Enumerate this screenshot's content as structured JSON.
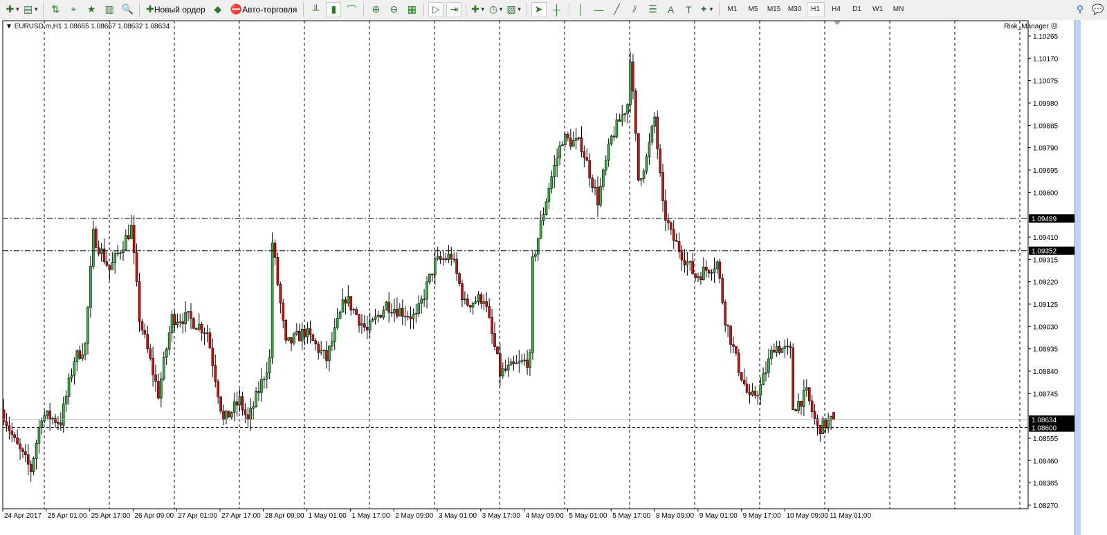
{
  "toolbar": {
    "items": [
      {
        "name": "new-chart-button",
        "glyph": "✚",
        "dd": true
      },
      {
        "name": "profiles-button",
        "glyph": "▤",
        "dd": true
      },
      {
        "sep": true
      },
      {
        "name": "market-watch-button",
        "glyph": "⇅"
      },
      {
        "name": "navigator-button",
        "glyph": "⌖"
      },
      {
        "name": "favorites-button",
        "glyph": "★"
      },
      {
        "name": "terminal-button",
        "glyph": "▥"
      },
      {
        "name": "strategy-tester-button",
        "glyph": "🔍"
      },
      {
        "sep": true
      },
      {
        "name": "new-order-button",
        "glyph": "✚",
        "label": "Новый ордер"
      },
      {
        "name": "metaeditor-button",
        "glyph": "◆"
      },
      {
        "name": "auto-trading-button",
        "glyph": "⛔",
        "label": "Авто-торговля"
      },
      {
        "sep": true
      },
      {
        "name": "bar-chart-button",
        "glyph": "╨"
      },
      {
        "name": "candlestick-button",
        "glyph": "▮",
        "active": true
      },
      {
        "name": "line-chart-button",
        "glyph": "⌒"
      },
      {
        "sep": true
      },
      {
        "name": "zoom-in-button",
        "glyph": "⊕"
      },
      {
        "name": "zoom-out-button",
        "glyph": "⊖"
      },
      {
        "name": "tile-windows-button",
        "glyph": "▦"
      },
      {
        "sep": true
      },
      {
        "name": "autoscroll-button",
        "glyph": "▷",
        "active": true
      },
      {
        "name": "chart-shift-button",
        "glyph": "⇥",
        "active": true
      },
      {
        "sep": true
      },
      {
        "name": "indicators-button",
        "glyph": "✚",
        "dd": true
      },
      {
        "name": "periods-button",
        "glyph": "◷",
        "dd": true
      },
      {
        "name": "templates-button",
        "glyph": "▨",
        "dd": true
      },
      {
        "sep": true
      },
      {
        "name": "cursor-button",
        "glyph": "➤",
        "active": true
      },
      {
        "name": "crosshair-button",
        "glyph": "┼"
      },
      {
        "sep": true
      },
      {
        "name": "vertical-line-button",
        "glyph": "│"
      },
      {
        "name": "horizontal-line-button",
        "glyph": "—"
      },
      {
        "name": "trendline-button",
        "glyph": "╱"
      },
      {
        "name": "equidistant-channel-button",
        "glyph": "⫽"
      },
      {
        "name": "fibonacci-button",
        "glyph": "☰"
      },
      {
        "name": "text-button",
        "glyph": "A"
      },
      {
        "name": "text-label-button",
        "glyph": "T"
      },
      {
        "name": "arrows-button",
        "glyph": "✦",
        "dd": true
      },
      {
        "sep": true
      }
    ],
    "timeframes": [
      "M1",
      "M5",
      "M15",
      "M30",
      "H1",
      "H4",
      "D1",
      "W1",
      "MN"
    ],
    "active_timeframe": "H1"
  },
  "chart": {
    "header": "EURUSD.m,H1  1.08665 1.08667 1.08632 1.08634",
    "indicator_label": "Risk_Manager",
    "price_ticks": [
      "1.10265",
      "1.10170",
      "1.10075",
      "1.09980",
      "1.09885",
      "1.09790",
      "1.09695",
      "1.09600",
      "1.09410",
      "1.09315",
      "1.09220",
      "1.09125",
      "1.09030",
      "1.08935",
      "1.08840",
      "1.08745",
      "1.08555",
      "1.08460",
      "1.08365",
      "1.08270"
    ],
    "time_labels": [
      "24 Apr 2017",
      "25 Apr 01:00",
      "25 Apr 17:00",
      "26 Apr 09:00",
      "27 Apr 01:00",
      "27 Apr 17:00",
      "28 Apr 09:00",
      "1 May 01:00",
      "1 May 17:00",
      "2 May 09:00",
      "3 May 01:00",
      "3 May 17:00",
      "4 May 09:00",
      "5 May 01:00",
      "5 May 17:00",
      "8 May 09:00",
      "9 May 01:00",
      "9 May 17:00",
      "10 May 09:00",
      "11 May 01:00"
    ],
    "hlines": [
      {
        "price": 1.09489,
        "label": "1.09489",
        "style": "dashdot"
      },
      {
        "price": 1.09352,
        "label": "1.09352",
        "style": "dashdot"
      },
      {
        "price": 1.086,
        "label": "1.08600",
        "style": "dashed"
      },
      {
        "price": 1.08634,
        "label": "1.08634",
        "style": "bid"
      }
    ],
    "colors": {
      "bull": "#3cb043",
      "bear": "#d01010",
      "wick": "#000000",
      "grid": "#000000",
      "bid": "#b0b0b0"
    }
  },
  "chart_data": {
    "type": "candlestick",
    "symbol": "EURUSD.m",
    "timeframe": "H1",
    "ylim": [
      1.0827,
      1.10265
    ],
    "bar_count": 307,
    "close_waypoints": [
      [
        0,
        1.08655
      ],
      [
        4,
        1.08538
      ],
      [
        10,
        1.0842
      ],
      [
        14,
        1.08655
      ],
      [
        21,
        1.08626
      ],
      [
        26,
        1.0889
      ],
      [
        30,
        1.08949
      ],
      [
        33,
        1.09419
      ],
      [
        39,
        1.09272
      ],
      [
        47,
        1.09448
      ],
      [
        50,
        1.09066
      ],
      [
        57,
        1.08743
      ],
      [
        62,
        1.09066
      ],
      [
        68,
        1.09066
      ],
      [
        75,
        1.09008
      ],
      [
        81,
        1.08626
      ],
      [
        87,
        1.08714
      ],
      [
        90,
        1.08626
      ],
      [
        98,
        1.0889
      ],
      [
        99,
        1.09389
      ],
      [
        104,
        1.08949
      ],
      [
        111,
        1.09008
      ],
      [
        119,
        1.0889
      ],
      [
        126,
        1.09154
      ],
      [
        134,
        1.09008
      ],
      [
        141,
        1.09125
      ],
      [
        152,
        1.09066
      ],
      [
        159,
        1.09301
      ],
      [
        165,
        1.09331
      ],
      [
        170,
        1.09125
      ],
      [
        177,
        1.09154
      ],
      [
        183,
        1.08831
      ],
      [
        194,
        1.0889
      ],
      [
        195,
        1.09301
      ],
      [
        201,
        1.09625
      ],
      [
        206,
        1.0983
      ],
      [
        213,
        1.09801
      ],
      [
        219,
        1.09566
      ],
      [
        224,
        1.0983
      ],
      [
        230,
        1.09977
      ],
      [
        231,
        1.10183
      ],
      [
        234,
        1.09654
      ],
      [
        237,
        1.09742
      ],
      [
        240,
        1.09918
      ],
      [
        243,
        1.09536
      ],
      [
        246,
        1.09419
      ],
      [
        252,
        1.09301
      ],
      [
        255,
        1.09243
      ],
      [
        263,
        1.09301
      ],
      [
        266,
        1.09066
      ],
      [
        270,
        1.0889
      ],
      [
        275,
        1.08714
      ],
      [
        279,
        1.08773
      ],
      [
        284,
        1.08949
      ],
      [
        290,
        1.0892
      ],
      [
        291,
        1.08684
      ],
      [
        296,
        1.08743
      ],
      [
        300,
        1.08596
      ],
      [
        306,
        1.08634
      ]
    ],
    "last_bar": {
      "open": 1.08665,
      "high": 1.08667,
      "low": 1.08632,
      "close": 1.08634
    }
  }
}
